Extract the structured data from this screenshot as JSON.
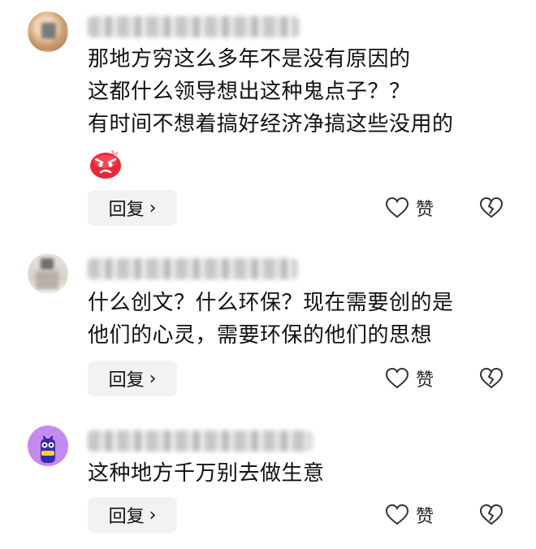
{
  "comments": [
    {
      "username": "",
      "location": "",
      "lines": [
        "那地方穷这么多年不是没有原因的",
        "这都什么领导想出这种鬼点子？？",
        "有时间不想着搞好经济净搞这些没用的"
      ],
      "emoji": "angry-face-emoji",
      "reply_label": "回复",
      "like_label": "赞"
    },
    {
      "username": "",
      "location": "",
      "lines": [
        "什么创文？什么环保？现在需要创的是",
        "他们的心灵，需要环保的他们的思想"
      ],
      "reply_label": "回复",
      "like_label": "赞"
    },
    {
      "username": "",
      "location": "",
      "lines": [
        "这种地方千万别去做生意"
      ],
      "reply_label": "回复",
      "like_label": "赞"
    }
  ],
  "icons": {
    "reply_chevron": "›",
    "like": "heart-outline-icon",
    "dislike": "broken-heart-icon"
  },
  "colors": {
    "background": "#ffffff",
    "reply_button_bg": "#f2f2f2",
    "emoji_red": "#e8283a",
    "avatar3_bg": "#c58af0"
  }
}
